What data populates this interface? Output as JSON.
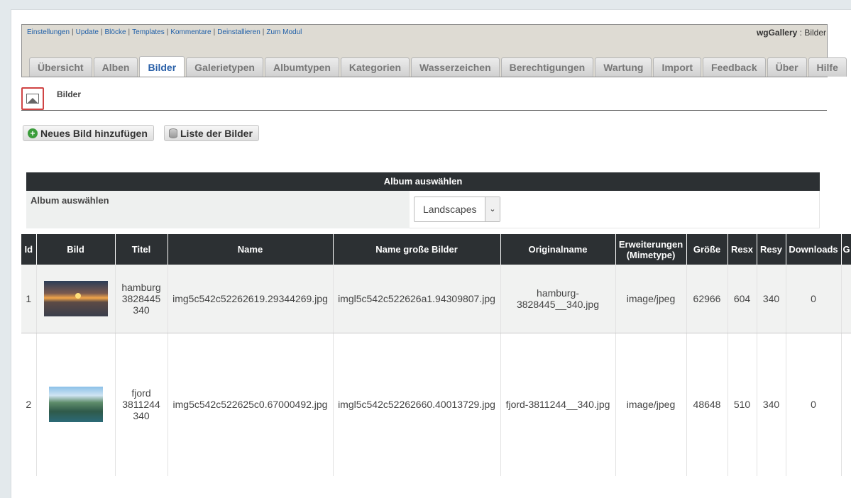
{
  "module": {
    "links": [
      "Einstellungen",
      "Update",
      "Blöcke",
      "Templates",
      "Kommentare",
      "Deinstallieren",
      "Zum Modul"
    ],
    "name": "wgGallery",
    "title_sep": " : ",
    "section": "Bilder"
  },
  "tabs": [
    "Übersicht",
    "Alben",
    "Bilder",
    "Galerietypen",
    "Albumtypen",
    "Kategorien",
    "Wasserzeichen",
    "Berechtigungen",
    "Wartung",
    "Import",
    "Feedback",
    "Über",
    "Hilfe"
  ],
  "active_tab": "Bilder",
  "page_heading": {
    "icon": "image-icon",
    "title": "Bilder"
  },
  "buttons": {
    "add": "Neues Bild hinzufügen",
    "list": "Liste der Bilder",
    "add_icon": "add-icon",
    "list_icon": "database-icon"
  },
  "album_form": {
    "header": "Album auswählen",
    "label": "Album auswählen",
    "selected": "Landscapes"
  },
  "table": {
    "headers": [
      "Id",
      "Bild",
      "Titel",
      "Name",
      "Name große Bilder",
      "Originalname",
      "Erweiterungen (Mimetype)",
      "Größe",
      "Resx",
      "Resy",
      "Downloads",
      "G"
    ],
    "rows": [
      {
        "id": "1",
        "thumb": "sunset-photo",
        "titel": "hamburg 3828445 340",
        "name": "img5c542c52262619.29344269.jpg",
        "name_large": "imgl5c542c522626a1.94309807.jpg",
        "original": "hamburg-3828445__340.jpg",
        "mimetype": "image/jpeg",
        "size": "62966",
        "resx": "604",
        "resy": "340",
        "downloads": "0"
      },
      {
        "id": "2",
        "thumb": "fjord-photo",
        "titel": "fjord 3811244 340",
        "name": "img5c542c522625c0.67000492.jpg",
        "name_large": "imgl5c542c52262660.40013729.jpg",
        "original": "fjord-3811244__340.jpg",
        "mimetype": "image/jpeg",
        "size": "48648",
        "resx": "510",
        "resy": "340",
        "downloads": "0"
      }
    ]
  },
  "colors": {
    "header_bg": "#2c3033",
    "link": "#1f5fa8",
    "active_tab": "#2a60a8"
  }
}
